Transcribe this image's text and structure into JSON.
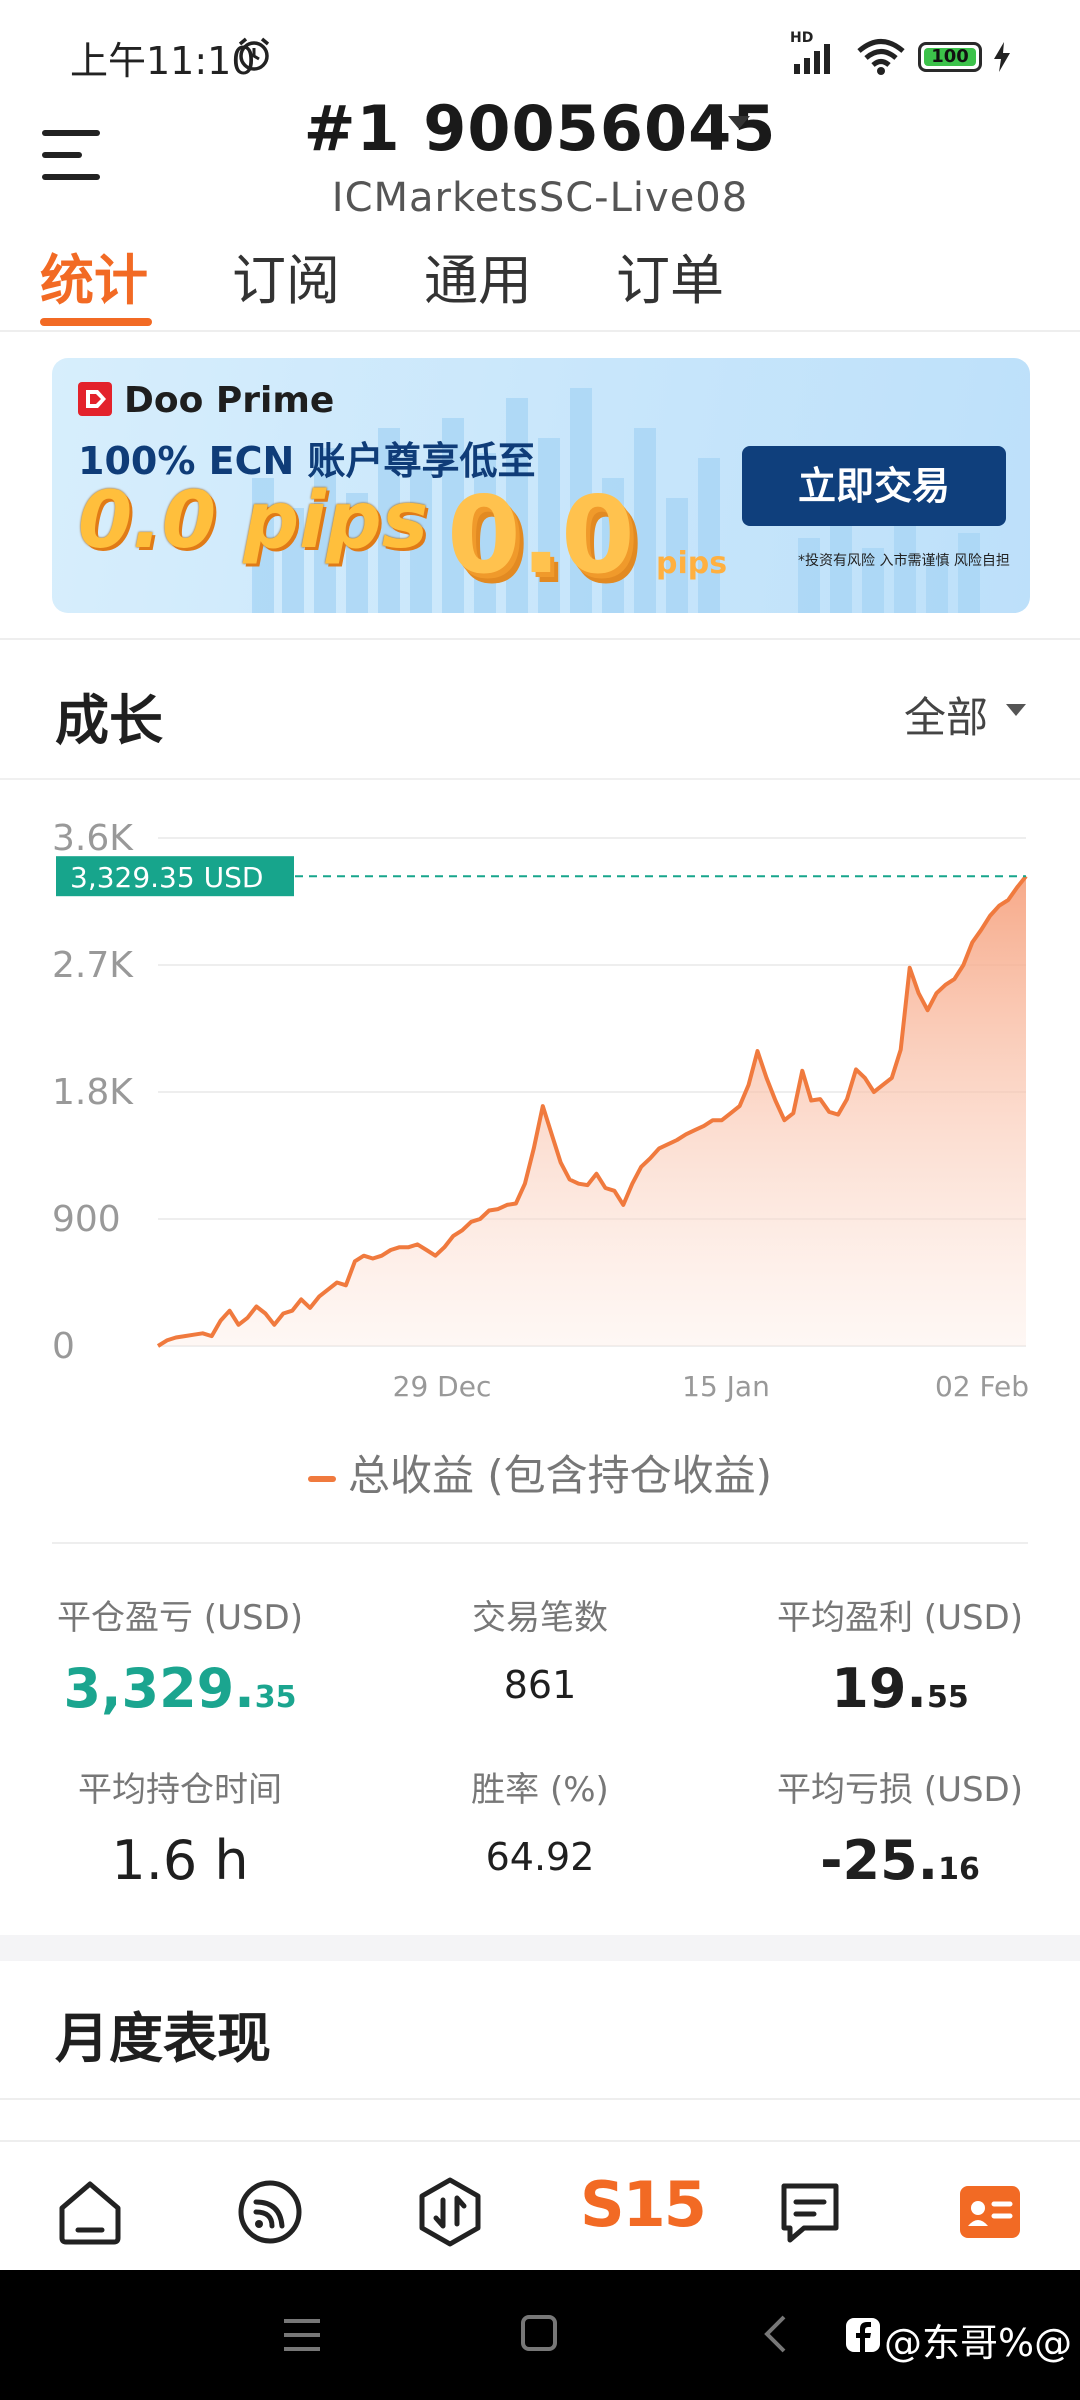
{
  "status_bar": {
    "time": "上午11:10",
    "battery": "100",
    "network": "HD"
  },
  "header": {
    "account_title": "#1  90056045",
    "server": "ICMarketsSC-Live08"
  },
  "tabs": [
    {
      "label": "统计",
      "active": true
    },
    {
      "label": "订阅",
      "active": false
    },
    {
      "label": "通用",
      "active": false
    },
    {
      "label": "订单",
      "active": false
    }
  ],
  "banner": {
    "brand": "Doo Prime",
    "headline": "100% ECN 账户尊享低至",
    "big_text": "0.0 pips",
    "graphic_text": "0.0",
    "graphic_small": "pips",
    "cta": "立即交易",
    "note": "*投资有风险 入市需谨慎 风险自担"
  },
  "growth": {
    "title": "成长",
    "range": "全部"
  },
  "chart_data": {
    "type": "area",
    "y_ticks": [
      "3.6K",
      "2.7K",
      "1.8K",
      "900",
      "0"
    ],
    "ylim": [
      0,
      3600
    ],
    "x_ticks": [
      "29 Dec",
      "15 Jan",
      "02 Feb"
    ],
    "current_label": "3,329.35 USD",
    "current_value": 3329.35,
    "series": [
      {
        "name": "总收益 (包含持仓收益)",
        "values": [
          0,
          40,
          60,
          70,
          80,
          90,
          70,
          180,
          250,
          150,
          200,
          280,
          230,
          150,
          230,
          250,
          330,
          270,
          350,
          400,
          450,
          430,
          600,
          640,
          620,
          640,
          680,
          700,
          700,
          720,
          680,
          640,
          700,
          780,
          820,
          880,
          900,
          960,
          970,
          1000,
          1010,
          1150,
          1400,
          1700,
          1500,
          1300,
          1180,
          1150,
          1140,
          1220,
          1120,
          1100,
          1000,
          1150,
          1270,
          1330,
          1400,
          1430,
          1460,
          1500,
          1530,
          1560,
          1600,
          1600,
          1650,
          1700,
          1850,
          2090,
          1900,
          1740,
          1600,
          1650,
          1950,
          1740,
          1750,
          1660,
          1640,
          1750,
          1960,
          1900,
          1800,
          1850,
          1900,
          2100,
          2680,
          2500,
          2380,
          2500,
          2560,
          2600,
          2700,
          2860,
          2950,
          3050,
          3120,
          3160,
          3250,
          3329.35
        ]
      }
    ],
    "series_color": "#f07a3e",
    "label_color": "#17a58c"
  },
  "legend": {
    "label": "总收益 (包含持仓收益)"
  },
  "stats": {
    "closed_pl": {
      "label": "平仓盈亏 (USD)",
      "int": "3,329.",
      "dec": "35"
    },
    "trades": {
      "label": "交易笔数",
      "value": "861"
    },
    "avg_profit": {
      "label": "平均盈利 (USD)",
      "int": "19.",
      "dec": "55"
    },
    "avg_hold": {
      "label": "平均持仓时间",
      "value": "1.6 h"
    },
    "win_rate": {
      "label": "胜率 (%)",
      "value": "64.92"
    },
    "avg_loss": {
      "label": "平均亏损 (USD)",
      "int": "-25.",
      "dec": "16"
    }
  },
  "monthly": {
    "title": "月度表现"
  },
  "bottom_nav": {
    "center_label": "S15"
  },
  "watermark": "@东哥%@"
}
